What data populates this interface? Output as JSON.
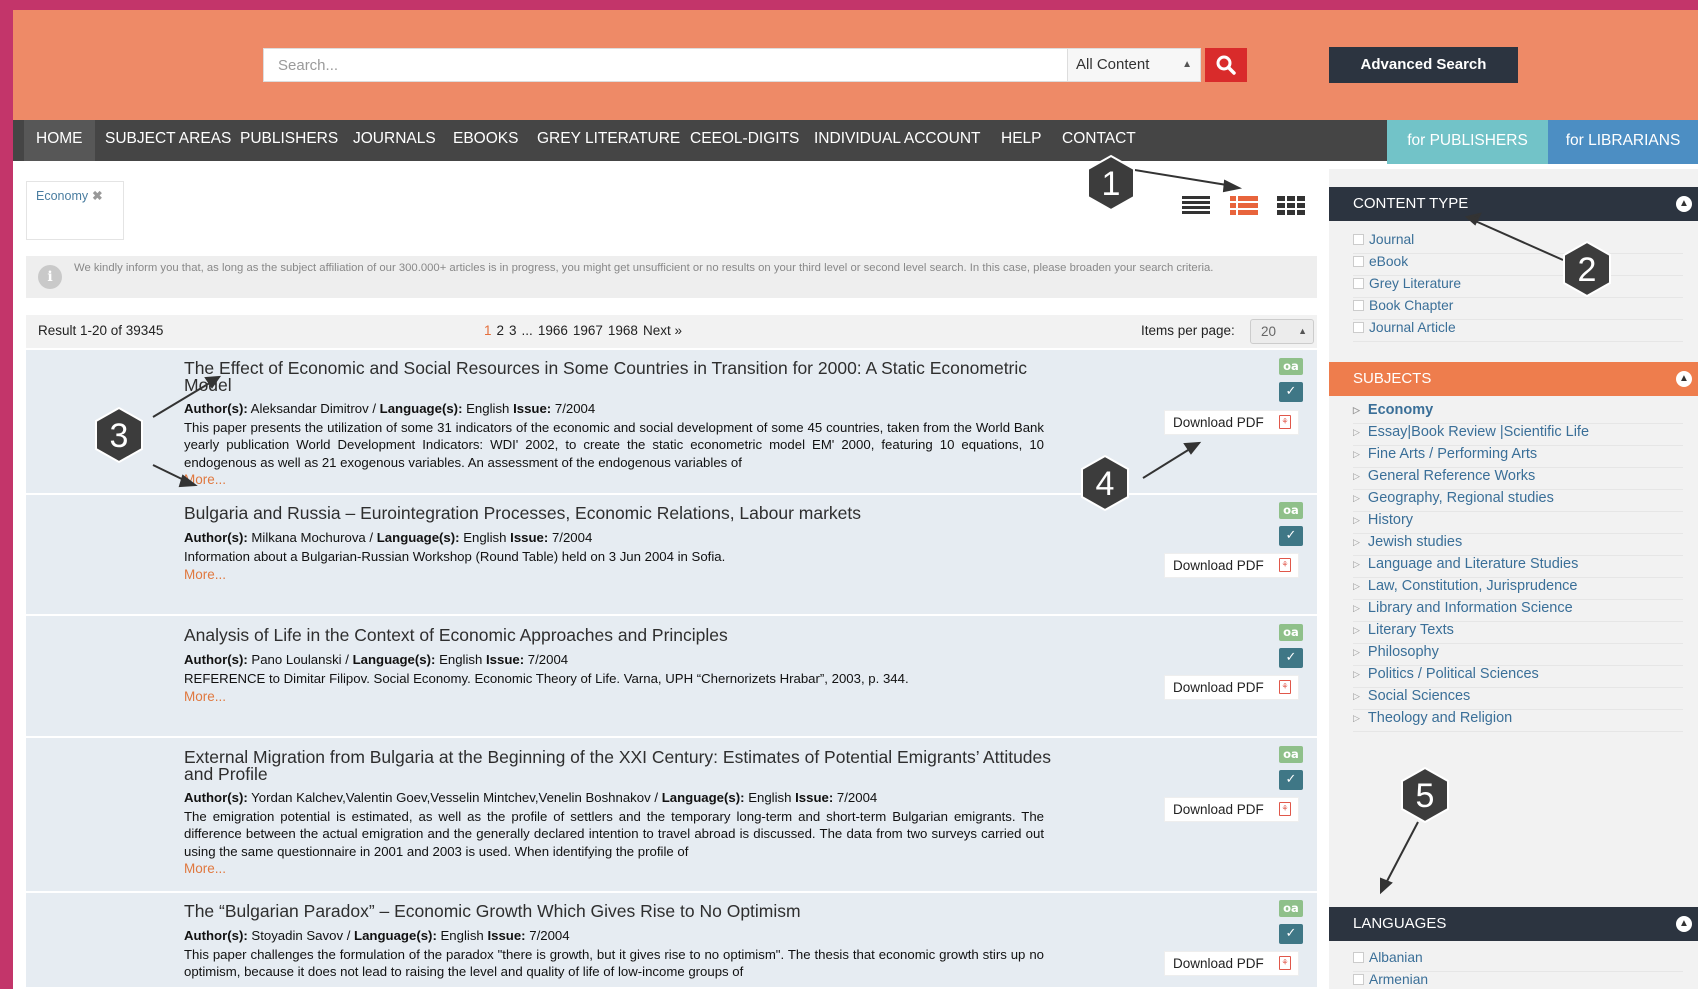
{
  "header": {
    "search_placeholder": "Search...",
    "content_select": "All Content",
    "advanced_search": "Advanced Search"
  },
  "nav": {
    "items": [
      "HOME",
      "SUBJECT AREAS",
      "PUBLISHERS",
      "JOURNALS",
      "EBOOKS",
      "GREY LITERATURE",
      "CEEOL-DIGITS",
      "INDIVIDUAL ACCOUNT",
      "HELP",
      "CONTACT"
    ],
    "for_publishers": "for PUBLISHERS",
    "for_librarians": "for LIBRARIANS"
  },
  "filter": {
    "tag": "Economy"
  },
  "notice": "We kindly inform you that, as long as the subject affiliation of our 300.000+ articles is in progress, you might get unsufficient or no results on your third level or second level search. In this case, please broaden your search criteria.",
  "results_bar": {
    "count": "Result 1-20 of 39345",
    "pages": [
      "1",
      "2",
      "3",
      "...",
      "1966",
      "1967",
      "1968",
      "Next »"
    ],
    "items_per_page_label": "Items per page:",
    "items_per_page": "20"
  },
  "results": [
    {
      "title": "The Effect of Economic and Social Resources in Some Countries in Transition for 2000: A Static Econometric Model",
      "authors": "Aleksandar Dimitrov",
      "language": "English",
      "issue": "7/2004",
      "description": "This paper presents the utilization of some 31 indicators of the economic and social development of some 45 countries, taken from the World Bank yearly publication World Development Indicators: WDI' 2002, to create the static econometric model EM' 2000, featuring 10 equations, 10 endogenous as well as 21 exogenous variables. An assessment of the endogenous variables of"
    },
    {
      "title": "Bulgaria and Russia – Eurointegration Processes, Economic Relations, Labour markets",
      "authors": "Milkana Mochurova",
      "language": "English",
      "issue": "7/2004",
      "description": "Information about a Bulgarian-Russian Workshop (Round Table) held on 3 Jun 2004 in Sofia."
    },
    {
      "title": "Analysis of Life in the Context of Economic Approaches and Principles",
      "authors": "Pano Loulanski",
      "language": "English",
      "issue": "7/2004",
      "description": "REFERENCE to Dimitar Filipov. Social Economy. Economic Theory of Life. Varna, UPH “Chernorizets Hrabar”, 2003, p. 344."
    },
    {
      "title": "External Migration from Bulgaria at the Beginning of the XXI Century: Estimates of Potential Emigrants’ Attitudes and Profile",
      "authors": "Yordan Kalchev,Valentin Goev,Vesselin Mintchev,Venelin Boshnakov",
      "language": "English",
      "issue": "7/2004",
      "description": "The emigration potential is estimated, as well as the profile of settlers and the temporary long-term and short-term Bulgarian emigrants. The difference between the actual emigration and the generally declared intention to travel abroad is discussed. The data from two surveys carried out using the same questionnaire in 2001 and 2003 is used. When identifying the profile of"
    },
    {
      "title": "The “Bulgarian Paradox” – Economic Growth Which Gives Rise to No Optimism",
      "authors": "Stoyadin Savov",
      "language": "English",
      "issue": "7/2004",
      "description": "This paper challenges the formulation of the paradox \"there is growth, but it gives rise to no optimism\". The thesis that economic growth stirs up no optimism, because it does not lead to raising the level and quality of life of low-income groups of"
    }
  ],
  "labels": {
    "authors": "Author(s):",
    "language": "Language(s):",
    "issue": "Issue:",
    "more": "More...",
    "download": "Download PDF",
    "oa": "oa",
    "pdf": "PDF"
  },
  "sidebar": {
    "content_type": {
      "title": "CONTENT TYPE",
      "items": [
        "Journal",
        "eBook",
        "Grey Literature",
        "Book Chapter",
        "Journal Article"
      ]
    },
    "subjects": {
      "title": "SUBJECTS",
      "items": [
        "Economy",
        "Essay|Book Review |Scientific Life",
        "Fine Arts / Performing Arts",
        "General Reference Works",
        "Geography, Regional studies",
        "History",
        "Jewish studies",
        "Language and Literature Studies",
        "Law, Constitution, Jurisprudence",
        "Library and Information Science",
        "Literary Texts",
        "Philosophy",
        "Politics / Political Sciences",
        "Social Sciences",
        "Theology and Religion"
      ]
    },
    "languages": {
      "title": "LANGUAGES",
      "items": [
        "Albanian",
        "Armenian"
      ]
    }
  },
  "callouts": [
    "1",
    "2",
    "3",
    "4",
    "5"
  ],
  "colors": {
    "header": "#ee8a67",
    "nav": "#454545",
    "accent": "#e56f3c",
    "search_button": "#d92b2b",
    "content_type_head": "#2c3440",
    "subjects_head": "#ee7d4d",
    "languages_head": "#2c3440"
  }
}
